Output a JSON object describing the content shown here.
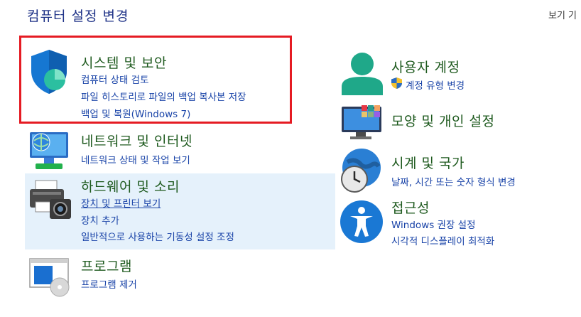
{
  "header": {
    "title": "컴퓨터 설정 변경",
    "view_by": "보기 기"
  },
  "categories": {
    "system_security": {
      "title": "시스템 및 보안",
      "links": [
        "컴퓨터 상태 검토",
        "파일 히스토리로 파일의 백업 복사본 저장",
        "백업 및 복원(Windows 7)"
      ]
    },
    "network": {
      "title": "네트워크 및 인터넷",
      "links": [
        "네트워크 상태 및 작업 보기"
      ]
    },
    "hardware": {
      "title": "하드웨어 및 소리",
      "links": [
        "장치 및 프린터 보기",
        "장치 추가",
        "일반적으로 사용하는 기동성 설정 조정"
      ]
    },
    "programs": {
      "title": "프로그램",
      "links": [
        "프로그램 제거"
      ]
    },
    "user_accounts": {
      "title": "사용자 계정",
      "links": [
        "계정 유형 변경"
      ]
    },
    "appearance": {
      "title": "모양 및 개인 설정",
      "links": []
    },
    "clock_region": {
      "title": "시계 및 국가",
      "links": [
        "날짜, 시간 또는 숫자 형식 변경"
      ]
    },
    "accessibility": {
      "title": "접근성",
      "links": [
        "Windows 권장 설정",
        "시각적 디스플레이 최적화"
      ]
    }
  },
  "colors": {
    "title_blue": "#1e3287",
    "category_green": "#1e5a1e",
    "link_blue": "#1a44a8",
    "highlight_red": "#e51b23",
    "hover_bg": "#e5f1fb"
  }
}
